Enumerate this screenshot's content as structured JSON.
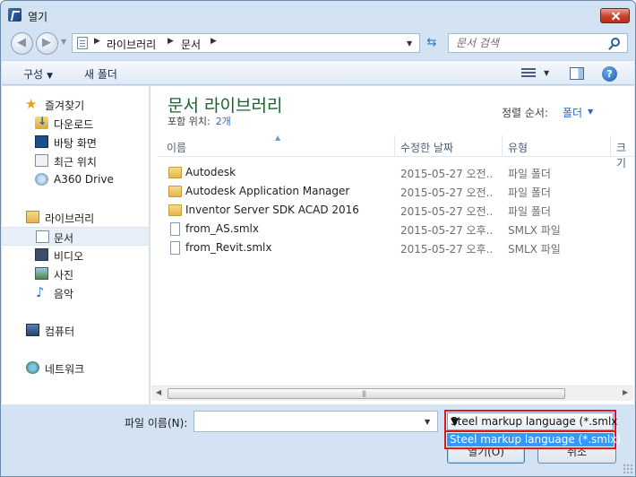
{
  "window": {
    "title": "열기"
  },
  "address": {
    "crumbs": [
      "라이브러리",
      "문서"
    ]
  },
  "search": {
    "placeholder": "문서 검색"
  },
  "toolbar": {
    "organize": "구성",
    "new_folder": "새 폴더"
  },
  "nav": {
    "favorites": "즐겨찾기",
    "downloads": "다운로드",
    "desktop": "바탕 화면",
    "recent": "최근 위치",
    "a360": "A360 Drive",
    "libraries": "라이브러리",
    "documents": "문서",
    "videos": "비디오",
    "pictures": "사진",
    "music": "음악",
    "computer": "컴퓨터",
    "network": "네트워크"
  },
  "library": {
    "title": "문서 라이브러리",
    "includes_label": "포함 위치:",
    "includes_count": "2개",
    "arrange_label": "정렬 순서:",
    "arrange_value": "폴더"
  },
  "columns": {
    "name": "이름",
    "date": "수정한 날짜",
    "type": "유형",
    "size": "크기"
  },
  "files": [
    {
      "name": "Autodesk",
      "date": "2015-05-27 오전...",
      "type": "파일 폴더",
      "kind": "folder"
    },
    {
      "name": "Autodesk Application Manager",
      "date": "2015-05-27 오전...",
      "type": "파일 폴더",
      "kind": "folder"
    },
    {
      "name": "Inventor Server SDK ACAD 2016",
      "date": "2015-05-27 오전...",
      "type": "파일 폴더",
      "kind": "folder"
    },
    {
      "name": "from_AS.smlx",
      "date": "2015-05-27 오후...",
      "type": "SMLX 파일",
      "kind": "file"
    },
    {
      "name": "from_Revit.smlx",
      "date": "2015-05-27 오후...",
      "type": "SMLX 파일",
      "kind": "file"
    }
  ],
  "bottom": {
    "filename_label": "파일 이름(N):",
    "filename_value": "",
    "filetype_selected": "Steel markup language (*.smlx",
    "filetype_option": "Steel markup language (*.smlx)",
    "open_button": "열기(O)",
    "cancel_button": "취소"
  },
  "colors": {
    "accent": "#3399ff",
    "highlight_border": "#e0141b",
    "library_title": "#1e5f2e",
    "link": "#1e6bc1"
  }
}
